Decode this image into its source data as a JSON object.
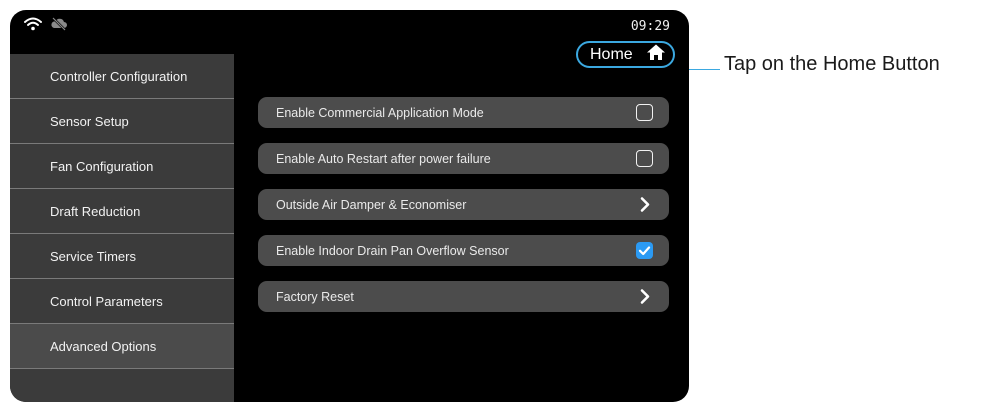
{
  "status": {
    "time": "09:29",
    "wifi_icon": "wifi-icon",
    "cloud_icon": "cloud-offline-icon"
  },
  "sidebar": {
    "items": [
      {
        "label": "Controller Configuration",
        "active": false
      },
      {
        "label": "Sensor Setup",
        "active": false
      },
      {
        "label": "Fan Configuration",
        "active": false
      },
      {
        "label": "Draft Reduction",
        "active": false
      },
      {
        "label": "Service Timers",
        "active": false
      },
      {
        "label": "Control Parameters",
        "active": false
      },
      {
        "label": "Advanced Options",
        "active": true
      }
    ]
  },
  "header": {
    "home_label": "Home",
    "home_icon": "home-icon"
  },
  "options": [
    {
      "label": "Enable Commercial Application Mode",
      "control": "checkbox",
      "checked": false
    },
    {
      "label": "Enable Auto Restart after power failure",
      "control": "checkbox",
      "checked": false
    },
    {
      "label": "Outside Air Damper & Economiser",
      "control": "chevron"
    },
    {
      "label": "Enable Indoor Drain Pan Overflow Sensor",
      "control": "checkbox",
      "checked": true
    },
    {
      "label": "Factory Reset",
      "control": "chevron"
    }
  ],
  "annotation": {
    "text": "Tap on the Home Button"
  },
  "colors": {
    "accent": "#3ba8e0",
    "checkbox_on": "#2b9af3",
    "row_bg": "#4c4c4c",
    "sidebar_bg": "#3b3b3b"
  }
}
